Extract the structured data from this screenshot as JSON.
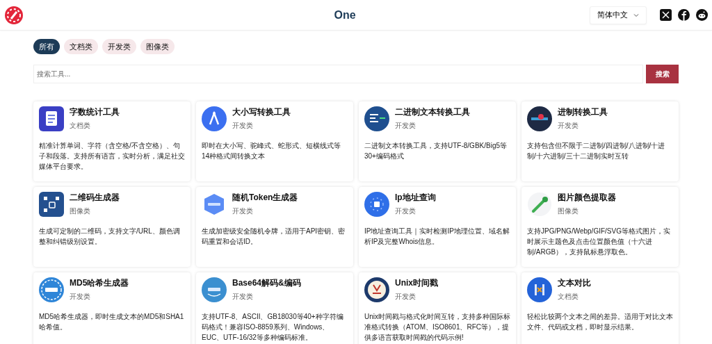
{
  "header": {
    "title": "One",
    "language": "简体中文"
  },
  "tabs": [
    {
      "label": "所有",
      "selected": true
    },
    {
      "label": "文档类",
      "selected": false
    },
    {
      "label": "开发类",
      "selected": false
    },
    {
      "label": "图像类",
      "selected": false
    }
  ],
  "search": {
    "placeholder": "搜索工具...",
    "button": "搜索"
  },
  "tools": [
    {
      "name": "字数统计工具",
      "category": "文档类",
      "description": "精准计算单词、字符（含空格/不含空格）、句子和段落。支持所有语言，实时分析，满足社交媒体平台要求。"
    },
    {
      "name": "大小写转换工具",
      "category": "开发类",
      "description": "即时在大小写、驼峰式、蛇形式、短横线式等14种格式间转换文本"
    },
    {
      "name": "二进制文本转换工具",
      "category": "开发类",
      "description": "二进制文本转换工具，支持UTF-8/GBK/Big5等30+编码格式"
    },
    {
      "name": "进制转换工具",
      "category": "开发类",
      "description": "支持包含但不限于二进制/四进制/八进制/十进制/十六进制/三十二进制实时互转"
    },
    {
      "name": "二维码生成器",
      "category": "图像类",
      "description": "生成可定制的二维码，支持文字/URL、颜色调整和纠错级别设置。"
    },
    {
      "name": "随机Token生成器",
      "category": "开发类",
      "description": "生成加密级安全随机令牌，适用于API密钥、密码重置和会话ID。"
    },
    {
      "name": "Ip地址查询",
      "category": "开发类",
      "description": "IP地址查询工具｜实时检测IP地理位置、域名解析IP及完整Whois信息。"
    },
    {
      "name": "图片颜色提取器",
      "category": "图像类",
      "description": "支持JPG/PNG/Webp/GIF/SVG等格式图片，实时展示主题色及点击位置颜色值（十六进制/ARGB），支持鼠标悬浮取色。"
    },
    {
      "name": "MD5哈希生成器",
      "category": "开发类",
      "description": "MD5哈希生成器，即时生成文本的MD5和SHA1哈希值。"
    },
    {
      "name": "Base64解码&编码",
      "category": "开发类",
      "description": "支持UTF-8、ASCII、GB18030等40+种字符编码格式！兼容ISO-8859系列、Windows、EUC、UTF-16/32等多种编码标准。"
    },
    {
      "name": "Unix时间戳",
      "category": "开发类",
      "description": "Unix时间戳与格式化时间互转，支持多种国际标准格式转换（ATOM、ISO8601、RFC等），提供多语言获取时间戳的代码示例!"
    },
    {
      "name": "文本对比",
      "category": "文档类",
      "description": "轻松比较两个文本之间的差异。适用于对比文本文件、代码或文档，即时显示结果。"
    }
  ]
}
